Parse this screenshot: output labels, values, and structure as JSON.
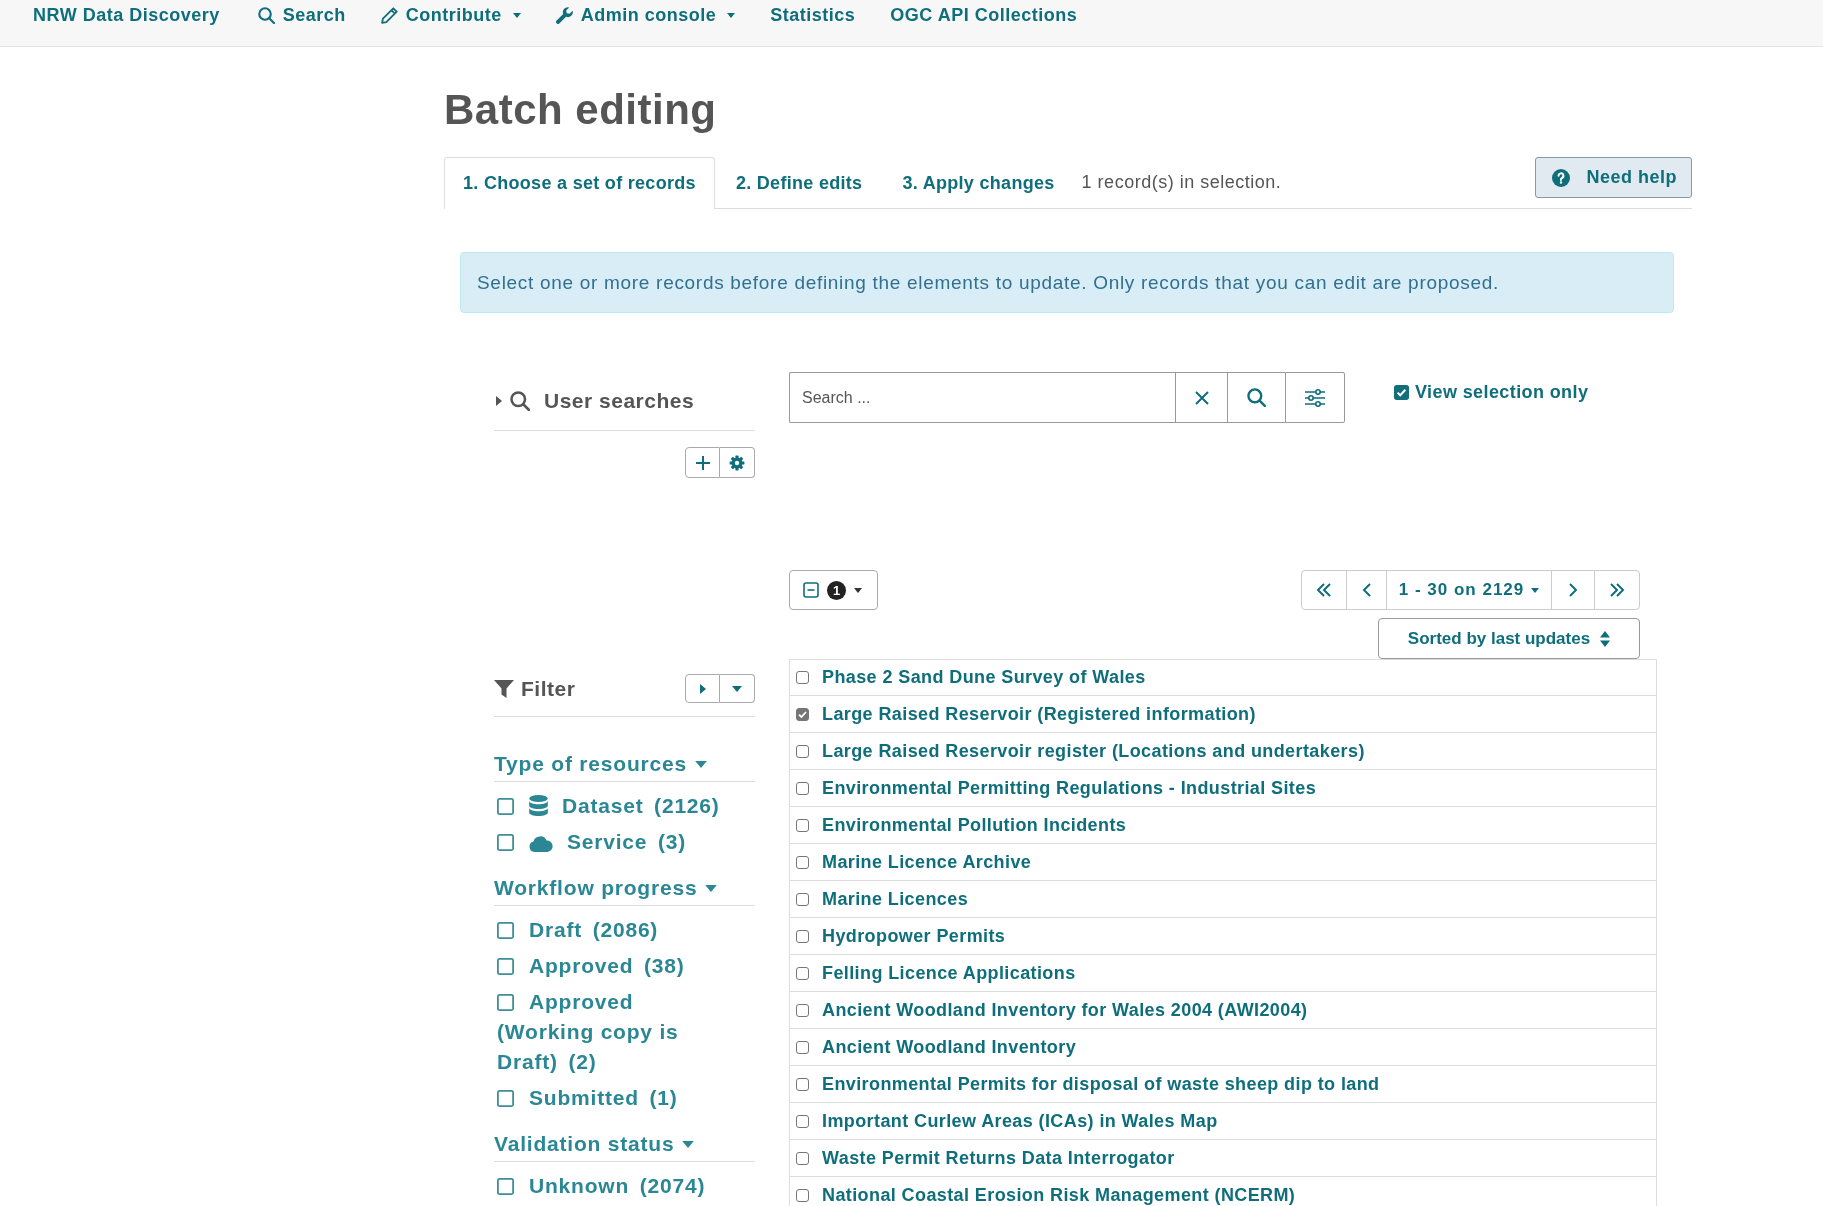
{
  "nav": {
    "items": [
      {
        "label": "NRW Data Discovery",
        "kind": "brand",
        "dropdown": false
      },
      {
        "label": "Search",
        "kind": "search",
        "dropdown": false
      },
      {
        "label": "Contribute",
        "kind": "edit",
        "dropdown": true
      },
      {
        "label": "Admin console",
        "kind": "tools",
        "dropdown": true
      },
      {
        "label": "Statistics",
        "kind": "plain",
        "dropdown": false
      },
      {
        "label": "OGC API Collections",
        "kind": "plain",
        "dropdown": false
      }
    ]
  },
  "page": {
    "title": "Batch editing"
  },
  "steps": {
    "tabs": [
      {
        "label": "1. Choose a set of records",
        "selected": true
      },
      {
        "label": "2. Define edits",
        "selected": false
      },
      {
        "label": "3. Apply changes",
        "selected": false
      }
    ],
    "selection_summary": "1 record(s) in selection.",
    "help_button": "Need help"
  },
  "alert": {
    "text": "Select one or more records before defining the elements to update. Only records that you can edit are proposed."
  },
  "user_searches": {
    "title": "User searches",
    "expanded": false
  },
  "search": {
    "placeholder": "Search ...",
    "view_selection_only": {
      "label": "View selection only",
      "checked": true
    }
  },
  "selection": {
    "count": "1"
  },
  "pager": {
    "range": "1 - 30 on 2129"
  },
  "sort": {
    "label": "Sorted by last updates"
  },
  "filter": {
    "title": "Filter",
    "groups": [
      {
        "title": "Type of resources",
        "expanded": true,
        "items": [
          {
            "label": "Dataset",
            "count": "(2126)",
            "kind": "dataset",
            "checked": false
          },
          {
            "label": "Service",
            "count": "(3)",
            "kind": "service",
            "checked": false
          }
        ]
      },
      {
        "title": "Workflow progress",
        "expanded": true,
        "items": [
          {
            "label": "Draft",
            "count": "(2086)",
            "kind": "plain",
            "checked": false
          },
          {
            "label": "Approved",
            "count": "(38)",
            "kind": "plain",
            "checked": false
          },
          {
            "label": "Approved (Working copy is Draft)",
            "count": "(2)",
            "kind": "plain",
            "checked": false
          },
          {
            "label": "Submitted",
            "count": "(1)",
            "kind": "plain",
            "checked": false
          }
        ]
      },
      {
        "title": "Validation status",
        "expanded": true,
        "items": [
          {
            "label": "Unknown",
            "count": "(2074)",
            "kind": "plain",
            "checked": false
          }
        ]
      }
    ]
  },
  "records": [
    {
      "title": "Phase 2 Sand Dune Survey of Wales",
      "selected": false
    },
    {
      "title": "Large Raised Reservoir (Registered information)",
      "selected": true
    },
    {
      "title": "Large Raised Reservoir register (Locations and undertakers)",
      "selected": false
    },
    {
      "title": "Environmental Permitting Regulations - Industrial Sites",
      "selected": false
    },
    {
      "title": "Environmental Pollution Incidents",
      "selected": false
    },
    {
      "title": "Marine Licence Archive",
      "selected": false
    },
    {
      "title": "Marine Licences",
      "selected": false
    },
    {
      "title": "Hydropower Permits",
      "selected": false
    },
    {
      "title": "Felling Licence Applications",
      "selected": false
    },
    {
      "title": "Ancient Woodland Inventory for Wales 2004 (AWI2004)",
      "selected": false
    },
    {
      "title": "Ancient Woodland Inventory",
      "selected": false
    },
    {
      "title": "Environmental Permits for disposal of waste sheep dip to land",
      "selected": false
    },
    {
      "title": "Important Curlew Areas (ICAs) in Wales Map",
      "selected": false
    },
    {
      "title": "Waste Permit Returns Data Interrogator",
      "selected": false
    },
    {
      "title": "National Coastal Erosion Risk Management (NCERM)",
      "selected": false
    }
  ]
}
